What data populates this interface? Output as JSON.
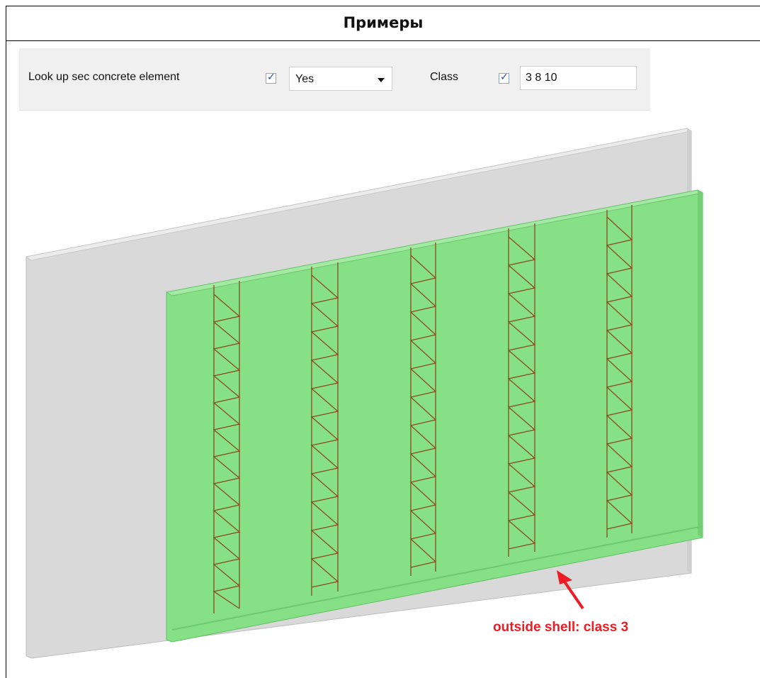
{
  "header": {
    "title": "Примеры"
  },
  "properties": {
    "lookup_label": "Look up sec concrete element",
    "lookup_checked": true,
    "lookup_value": "Yes",
    "class_label": "Class",
    "class_checked": true,
    "class_value": "3 8 10"
  },
  "viewport": {
    "back_panel_color": "#dcdcdc",
    "front_shell_color": "#86e086",
    "rebar_color": "#8a4b1e",
    "annotation_text": "outside shell: class 3",
    "annotation_color": "#ee1c24"
  }
}
